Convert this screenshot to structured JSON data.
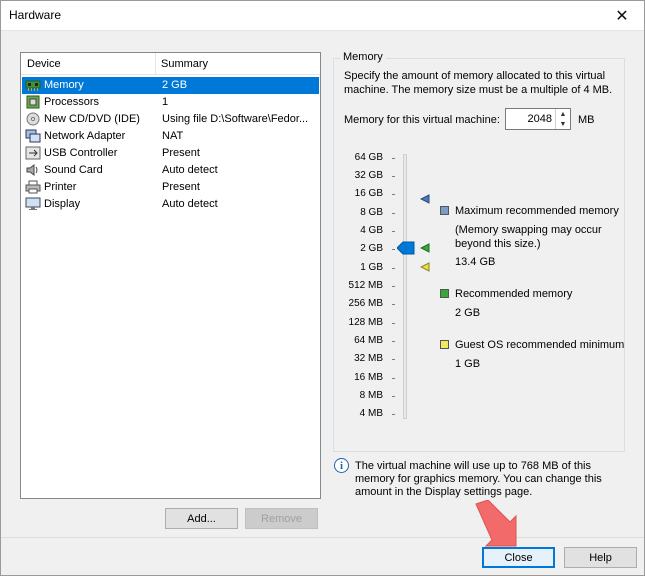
{
  "window": {
    "title": "Hardware",
    "close_glyph": "✕"
  },
  "device_list": {
    "col_device": "Device",
    "col_summary": "Summary",
    "items": [
      {
        "name": "Memory",
        "summary": "2 GB",
        "icon": "memory-icon"
      },
      {
        "name": "Processors",
        "summary": "1",
        "icon": "processor-icon"
      },
      {
        "name": "New CD/DVD (IDE)",
        "summary": "Using file D:\\Software\\Fedor...",
        "icon": "cd-dvd-icon"
      },
      {
        "name": "Network Adapter",
        "summary": "NAT",
        "icon": "network-adapter-icon"
      },
      {
        "name": "USB Controller",
        "summary": "Present",
        "icon": "usb-icon"
      },
      {
        "name": "Sound Card",
        "summary": "Auto detect",
        "icon": "sound-card-icon"
      },
      {
        "name": "Printer",
        "summary": "Present",
        "icon": "printer-icon"
      },
      {
        "name": "Display",
        "summary": "Auto detect",
        "icon": "display-icon"
      }
    ],
    "add_label": "Add...",
    "remove_label": "Remove"
  },
  "memory": {
    "group_label": "Memory",
    "description": "Specify the amount of memory allocated to this virtual machine. The memory size must be a multiple of 4 MB.",
    "field_label": "Memory for this virtual machine:",
    "value": "2048",
    "unit": "MB",
    "slider_ticks": [
      "64 GB",
      "32 GB",
      "16 GB",
      "8 GB",
      "4 GB",
      "2 GB",
      "1 GB",
      "512 MB",
      "256 MB",
      "128 MB",
      "64 MB",
      "32 MB",
      "16 MB",
      "8 MB",
      "4 MB"
    ],
    "slider_selected": "2 GB",
    "legend": {
      "max_title": "Maximum recommended memory",
      "max_note": "(Memory swapping may occur beyond this size.)",
      "max_value": "13.4 GB",
      "rec_title": "Recommended memory",
      "rec_value": "2 GB",
      "min_title": "Guest OS recommended minimum",
      "min_value": "1 GB"
    },
    "colors": {
      "max": "#4a78b8",
      "recommended": "#3aa53a",
      "minimum": "#e8e040",
      "accent": "#0078d7"
    },
    "info_text": "The virtual machine will use up to 768 MB of this memory for graphics memory. You can change this amount in the Display settings page."
  },
  "footer": {
    "close_label": "Close",
    "help_label": "Help"
  }
}
